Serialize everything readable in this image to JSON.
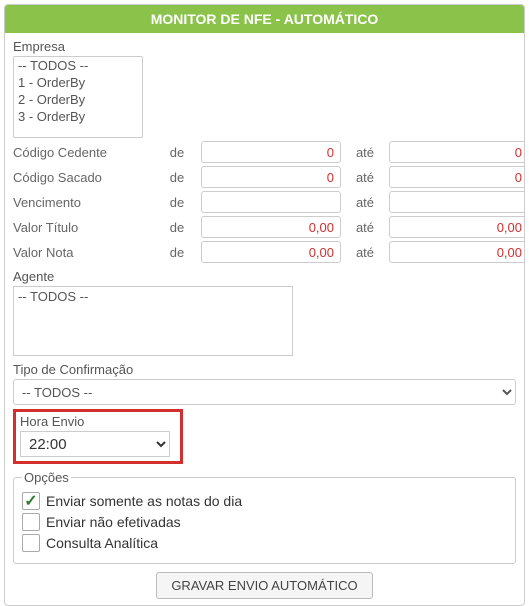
{
  "header": {
    "title": "MONITOR DE NFE - AUTOMÁTICO"
  },
  "empresa": {
    "label": "Empresa",
    "options": [
      "-- TODOS --",
      "1 - OrderBy",
      "2 - OrderBy",
      "3 - OrderBy"
    ]
  },
  "labels": {
    "de": "de",
    "ate": "até"
  },
  "fields": {
    "codigo_cedente": {
      "label": "Código Cedente",
      "de": "0",
      "ate": "0"
    },
    "codigo_sacado": {
      "label": "Código Sacado",
      "de": "0",
      "ate": "0"
    },
    "vencimento": {
      "label": "Vencimento",
      "de": "",
      "ate": ""
    },
    "valor_titulo": {
      "label": "Valor Título",
      "de": "0,00",
      "ate": "0,00"
    },
    "valor_nota": {
      "label": "Valor Nota",
      "de": "0,00",
      "ate": "0,00"
    }
  },
  "agente": {
    "label": "Agente",
    "items": [
      "-- TODOS --"
    ]
  },
  "tipo_confirmacao": {
    "label": "Tipo de Confirmação",
    "selected": "-- TODOS --"
  },
  "hora_envio": {
    "label": "Hora Envio",
    "selected": "22:00"
  },
  "opcoes": {
    "legend": "Opções",
    "enviar_dia": {
      "label": "Enviar somente as notas do dia",
      "checked": true
    },
    "enviar_nao_efetivadas": {
      "label": "Enviar não efetivadas",
      "checked": false
    },
    "consulta_analitica": {
      "label": "Consulta Analítica",
      "checked": false
    }
  },
  "actions": {
    "gravar": "GRAVAR ENVIO AUTOMÁTICO"
  }
}
